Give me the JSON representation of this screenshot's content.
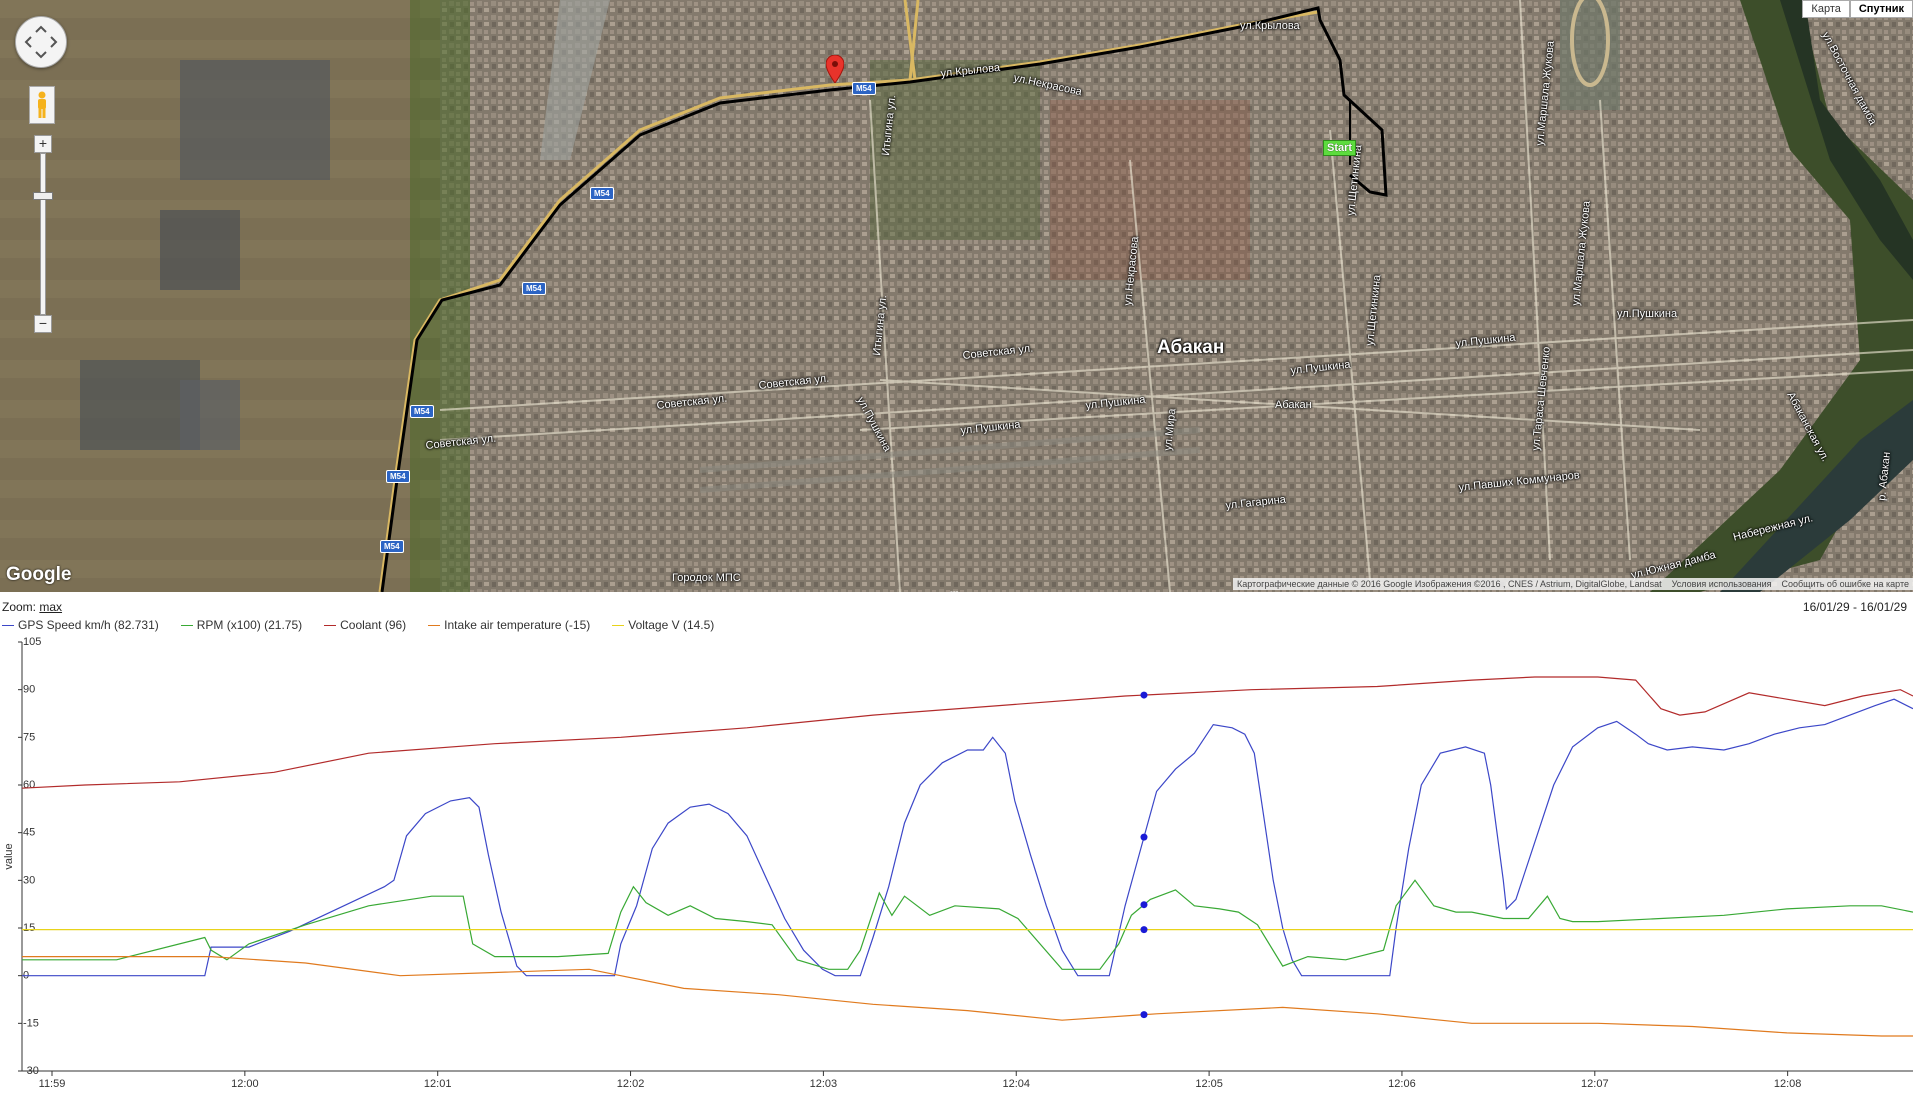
{
  "map": {
    "map_type_buttons": [
      {
        "label": "Карта",
        "active": false
      },
      {
        "label": "Спутник",
        "active": true
      }
    ],
    "google_logo": "Google",
    "attribution": {
      "data_text": "Картографические данные © 2016 Google Изображения ©2016 , CNES / Astrium, DigitalGlobe, Landsat",
      "terms_link": "Условия использования",
      "report_link": "Сообщить об ошибке на карте"
    },
    "start_marker_label": "Start",
    "city_label": "Абакан",
    "street_labels": [
      "ул.Крылова",
      "ул.Крылова",
      "ул.Некрасова",
      "Итыгина ул.",
      "ул.Некрасова",
      "ул.Щетинкина",
      "ул.Щетинкина",
      "ул.Маршала Жукова",
      "ул.Маршала Жукова",
      "ул.Восточная дамба",
      "Итыгина ул.",
      "Советская ул.",
      "Советская ул.",
      "Советская ул.",
      "Советская ул.",
      "ул.Пушкина",
      "ул.Пушкина",
      "ул.Пушкина",
      "ул.Пушкина",
      "ул.Пушкина",
      "ул.Пушкина",
      "ул.Мира",
      "ул.Тараса Шевченко",
      "ул.Павших Коммунаров",
      "ул.Гагарина",
      "Абаканская ул.",
      "Набережная ул.",
      "ул.Южная дамба",
      "р. Абакан",
      "Городок МПС",
      "Абакан"
    ],
    "highway_shield": "М54",
    "icons": {
      "pan": "pan-control-icon",
      "pegman": "street-view-pegman-icon",
      "zoom_in": "zoom-in-icon",
      "zoom_out": "zoom-out-icon",
      "pin": "location-pin-icon",
      "train": "train-station-icon"
    },
    "zoom_in_label": "+",
    "zoom_out_label": "−"
  },
  "chart_header": {
    "zoom_label": "Zoom:",
    "zoom_value": "max",
    "date_range": "16/01/29 - 16/01/29"
  },
  "chart_data": {
    "type": "line",
    "title": "",
    "xlabel": "",
    "ylabel": "value",
    "x_ticks": [
      "11:59",
      "12:00",
      "12:01",
      "12:02",
      "12:03",
      "12:04",
      "12:05",
      "12:06",
      "12:07",
      "12:08"
    ],
    "y_ticks": [
      105,
      90,
      75,
      60,
      45,
      30,
      15,
      0,
      -15,
      -30
    ],
    "ylim": [
      -30,
      105
    ],
    "xlim_seconds_from_1159": [
      0,
      600
    ],
    "legend_position": "top-left",
    "cursor_time_seconds": 356,
    "series": [
      {
        "name": "GPS Speed km/h (82.731)",
        "color": "#3c47c8",
        "points": [
          [
            0,
            0
          ],
          [
            20,
            0
          ],
          [
            40,
            0
          ],
          [
            58,
            0
          ],
          [
            60,
            9
          ],
          [
            72,
            9
          ],
          [
            85,
            14
          ],
          [
            100,
            21
          ],
          [
            115,
            28
          ],
          [
            118,
            30
          ],
          [
            122,
            44
          ],
          [
            128,
            51
          ],
          [
            136,
            55
          ],
          [
            142,
            56
          ],
          [
            145,
            53
          ],
          [
            148,
            38
          ],
          [
            152,
            20
          ],
          [
            157,
            3
          ],
          [
            160,
            0
          ],
          [
            170,
            0
          ],
          [
            180,
            0
          ],
          [
            188,
            0
          ],
          [
            190,
            10
          ],
          [
            195,
            22
          ],
          [
            200,
            40
          ],
          [
            205,
            48
          ],
          [
            212,
            53
          ],
          [
            218,
            54
          ],
          [
            224,
            51
          ],
          [
            230,
            44
          ],
          [
            236,
            31
          ],
          [
            242,
            18
          ],
          [
            248,
            8
          ],
          [
            254,
            2
          ],
          [
            258,
            0
          ],
          [
            262,
            0
          ],
          [
            266,
            0
          ],
          [
            270,
            12
          ],
          [
            275,
            28
          ],
          [
            280,
            48
          ],
          [
            285,
            60
          ],
          [
            292,
            67
          ],
          [
            300,
            71
          ],
          [
            305,
            71
          ],
          [
            308,
            75
          ],
          [
            312,
            70
          ],
          [
            315,
            55
          ],
          [
            320,
            38
          ],
          [
            325,
            22
          ],
          [
            330,
            8
          ],
          [
            335,
            0
          ],
          [
            342,
            0
          ],
          [
            345,
            0
          ],
          [
            350,
            22
          ],
          [
            355,
            40
          ],
          [
            360,
            58
          ],
          [
            366,
            65
          ],
          [
            372,
            70
          ],
          [
            378,
            79
          ],
          [
            384,
            78
          ],
          [
            388,
            76
          ],
          [
            391,
            70
          ],
          [
            394,
            50
          ],
          [
            397,
            30
          ],
          [
            400,
            15
          ],
          [
            403,
            5
          ],
          [
            406,
            0
          ],
          [
            412,
            0
          ],
          [
            420,
            0
          ],
          [
            425,
            0
          ],
          [
            430,
            0
          ],
          [
            434,
            0
          ],
          [
            436,
            15
          ],
          [
            440,
            40
          ],
          [
            444,
            60
          ],
          [
            450,
            70
          ],
          [
            458,
            72
          ],
          [
            464,
            70
          ],
          [
            466,
            60
          ],
          [
            468,
            45
          ],
          [
            470,
            30
          ],
          [
            471,
            21
          ],
          [
            474,
            24
          ],
          [
            480,
            42
          ],
          [
            486,
            60
          ],
          [
            492,
            72
          ],
          [
            500,
            78
          ],
          [
            506,
            80
          ],
          [
            512,
            76
          ],
          [
            516,
            73
          ],
          [
            522,
            71
          ],
          [
            530,
            72
          ],
          [
            540,
            71
          ],
          [
            548,
            73
          ],
          [
            556,
            76
          ],
          [
            564,
            78
          ],
          [
            572,
            79
          ],
          [
            580,
            82
          ],
          [
            588,
            85
          ],
          [
            594,
            87
          ],
          [
            600,
            84
          ]
        ]
      },
      {
        "name": "RPM (x100) (21.75)",
        "color": "#39a935",
        "points": [
          [
            0,
            5
          ],
          [
            30,
            5
          ],
          [
            58,
            12
          ],
          [
            60,
            8
          ],
          [
            65,
            5
          ],
          [
            72,
            10
          ],
          [
            90,
            16
          ],
          [
            110,
            22
          ],
          [
            130,
            25
          ],
          [
            140,
            25
          ],
          [
            143,
            10
          ],
          [
            150,
            6
          ],
          [
            170,
            6
          ],
          [
            186,
            7
          ],
          [
            190,
            20
          ],
          [
            194,
            28
          ],
          [
            198,
            23
          ],
          [
            205,
            19
          ],
          [
            212,
            22
          ],
          [
            220,
            18
          ],
          [
            230,
            17
          ],
          [
            238,
            16
          ],
          [
            246,
            5
          ],
          [
            256,
            2
          ],
          [
            262,
            2
          ],
          [
            266,
            8
          ],
          [
            272,
            26
          ],
          [
            276,
            19
          ],
          [
            280,
            25
          ],
          [
            288,
            19
          ],
          [
            296,
            22
          ],
          [
            310,
            21
          ],
          [
            316,
            18
          ],
          [
            330,
            2
          ],
          [
            336,
            2
          ],
          [
            342,
            2
          ],
          [
            348,
            10
          ],
          [
            352,
            19
          ],
          [
            358,
            24
          ],
          [
            366,
            27
          ],
          [
            372,
            22
          ],
          [
            380,
            21
          ],
          [
            386,
            20
          ],
          [
            392,
            16
          ],
          [
            400,
            3
          ],
          [
            408,
            6
          ],
          [
            420,
            5
          ],
          [
            432,
            8
          ],
          [
            436,
            22
          ],
          [
            442,
            30
          ],
          [
            448,
            22
          ],
          [
            455,
            20
          ],
          [
            460,
            20
          ],
          [
            470,
            18
          ],
          [
            478,
            18
          ],
          [
            484,
            25
          ],
          [
            488,
            18
          ],
          [
            492,
            17
          ],
          [
            500,
            17
          ],
          [
            520,
            18
          ],
          [
            540,
            19
          ],
          [
            560,
            21
          ],
          [
            580,
            22
          ],
          [
            590,
            22
          ],
          [
            600,
            20
          ]
        ]
      },
      {
        "name": "Coolant (96)",
        "color": "#b22b2b",
        "points": [
          [
            0,
            59
          ],
          [
            20,
            60
          ],
          [
            50,
            61
          ],
          [
            80,
            64
          ],
          [
            110,
            70
          ],
          [
            150,
            73
          ],
          [
            190,
            75
          ],
          [
            230,
            78
          ],
          [
            270,
            82
          ],
          [
            310,
            85
          ],
          [
            350,
            88
          ],
          [
            390,
            90
          ],
          [
            430,
            91
          ],
          [
            460,
            93
          ],
          [
            480,
            94
          ],
          [
            500,
            94
          ],
          [
            512,
            93
          ],
          [
            520,
            84
          ],
          [
            526,
            82
          ],
          [
            534,
            83
          ],
          [
            548,
            89
          ],
          [
            560,
            87
          ],
          [
            572,
            85
          ],
          [
            584,
            88
          ],
          [
            596,
            90
          ],
          [
            600,
            88
          ]
        ]
      },
      {
        "name": "Intake air temperature (-15)",
        "color": "#e07a1e",
        "points": [
          [
            0,
            6
          ],
          [
            30,
            6
          ],
          [
            60,
            6
          ],
          [
            90,
            4
          ],
          [
            120,
            0
          ],
          [
            150,
            1
          ],
          [
            180,
            2
          ],
          [
            210,
            -4
          ],
          [
            240,
            -6
          ],
          [
            270,
            -9
          ],
          [
            300,
            -11
          ],
          [
            330,
            -14
          ],
          [
            360,
            -12
          ],
          [
            400,
            -10
          ],
          [
            430,
            -12
          ],
          [
            460,
            -15
          ],
          [
            500,
            -15
          ],
          [
            530,
            -16
          ],
          [
            560,
            -18
          ],
          [
            590,
            -19
          ],
          [
            600,
            -19
          ]
        ]
      },
      {
        "name": "Voltage V (14.5)",
        "color": "#e8d31a",
        "points": [
          [
            0,
            14.5
          ],
          [
            600,
            14.5
          ]
        ]
      }
    ]
  }
}
